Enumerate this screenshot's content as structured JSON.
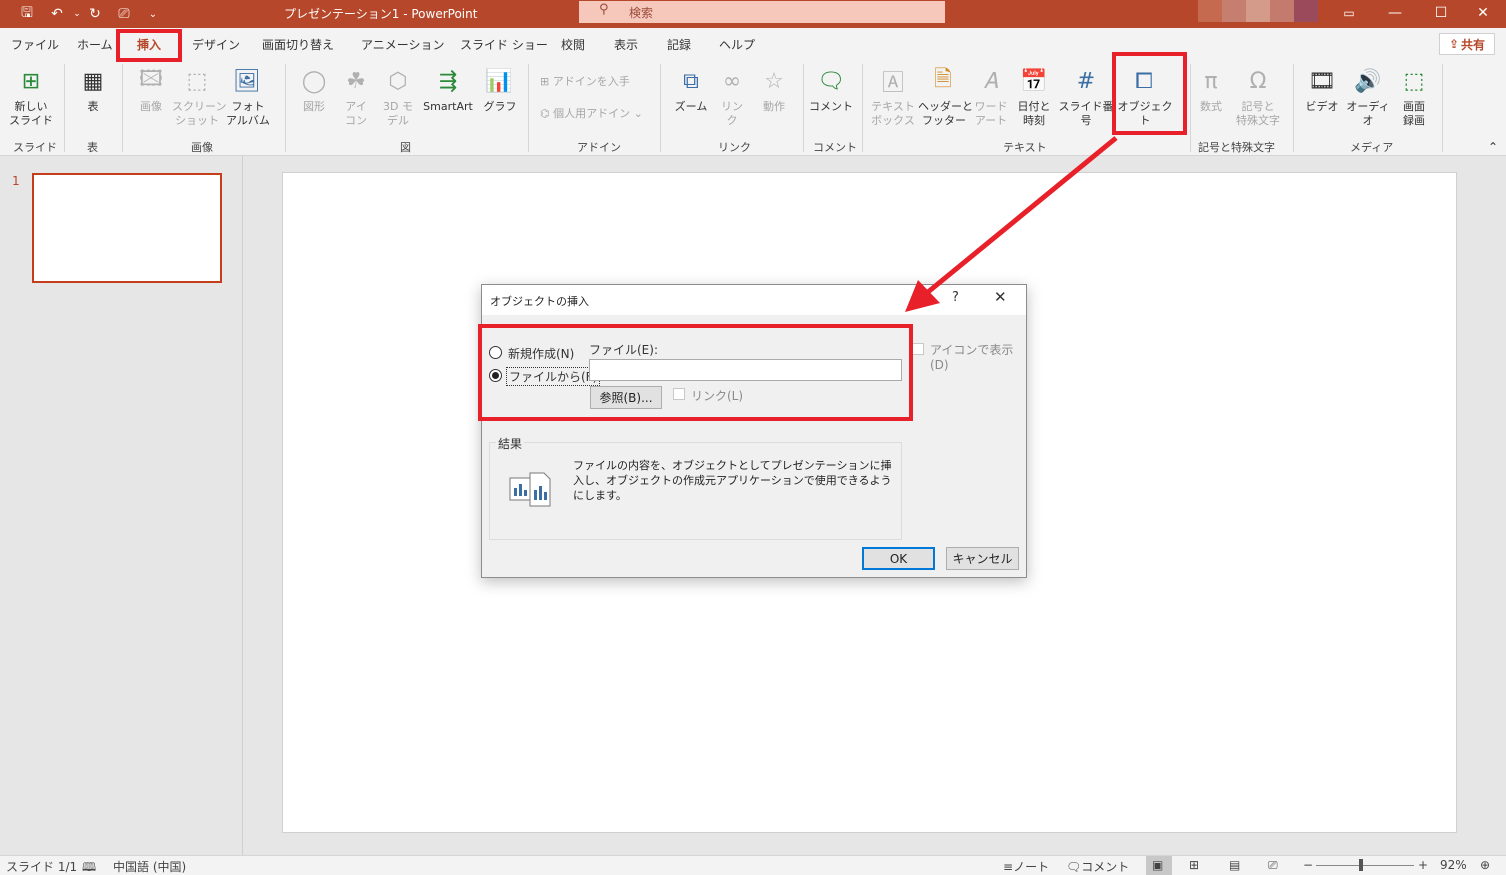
{
  "window": {
    "doc_title": "プレゼンテーション1  -  PowerPoint",
    "search_placeholder": "検索"
  },
  "tabs": [
    "ファイル",
    "ホーム",
    "挿入",
    "デザイン",
    "画面切り替え",
    "アニメーション",
    "スライド ショー",
    "校閲",
    "表示",
    "記録",
    "ヘルプ"
  ],
  "share_label": "共有",
  "ribbon": {
    "new_slide": "新しい\nスライド",
    "table": "表",
    "image": "画像",
    "screenshot": "スクリーン\nショット",
    "photo_album": "フォト\nアルバム",
    "shapes": "図形",
    "icons": "アイ\nコン",
    "model3d": "3D モ\nデル",
    "smartart": "SmartArt",
    "graph": "グラフ",
    "get_addins": "アドインを入手",
    "my_addins": "個人用アドイン",
    "zoom": "ズーム",
    "link": "リン\nク",
    "action": "動作",
    "comment": "コメント",
    "textbox": "テキスト\nボックス",
    "header_footer": "ヘッダーと\nフッター",
    "wordart": "ワード\nアート",
    "datetime": "日付と\n時刻",
    "slide_number": "スライド番号",
    "object": "オブジェクト",
    "equation": "数式",
    "symbol": "記号と\n特殊文字",
    "video": "ビデオ",
    "audio": "オーディオ",
    "screen_record": "画面\n録画",
    "groups": {
      "slides": "スライド",
      "table": "表",
      "images": "画像",
      "illustrations": "図",
      "addins": "アドイン",
      "links": "リンク",
      "comments": "コメント",
      "text": "テキスト",
      "symbols": "記号と特殊文字",
      "media": "メディア"
    }
  },
  "slide_panel": {
    "number": "1"
  },
  "dialog": {
    "title": "オブジェクトの挿入",
    "help": "?",
    "close": "✕",
    "new_option": "新規作成(N)",
    "from_file_option": "ファイルから(F)",
    "file_label": "ファイル(E):",
    "file_value": "",
    "browse_button": "参照(B)...",
    "link_label": "リンク(L)",
    "display_icon_label": "アイコンで表示(D)",
    "result_title": "結果",
    "result_text": "ファイルの内容を、オブジェクトとしてプレゼンテーションに挿入し、オブジェクトの作成元アプリケーションで使用できるようにします。",
    "ok": "OK",
    "cancel": "キャンセル"
  },
  "status": {
    "slide_info": "スライド 1/1",
    "language": "中国語 (中国)",
    "notes": "ノート",
    "comments": "コメント",
    "zoom": "92%"
  },
  "colors": {
    "accent": "#b7472a",
    "highlight": "#e8202a",
    "focus": "#0078d7"
  }
}
